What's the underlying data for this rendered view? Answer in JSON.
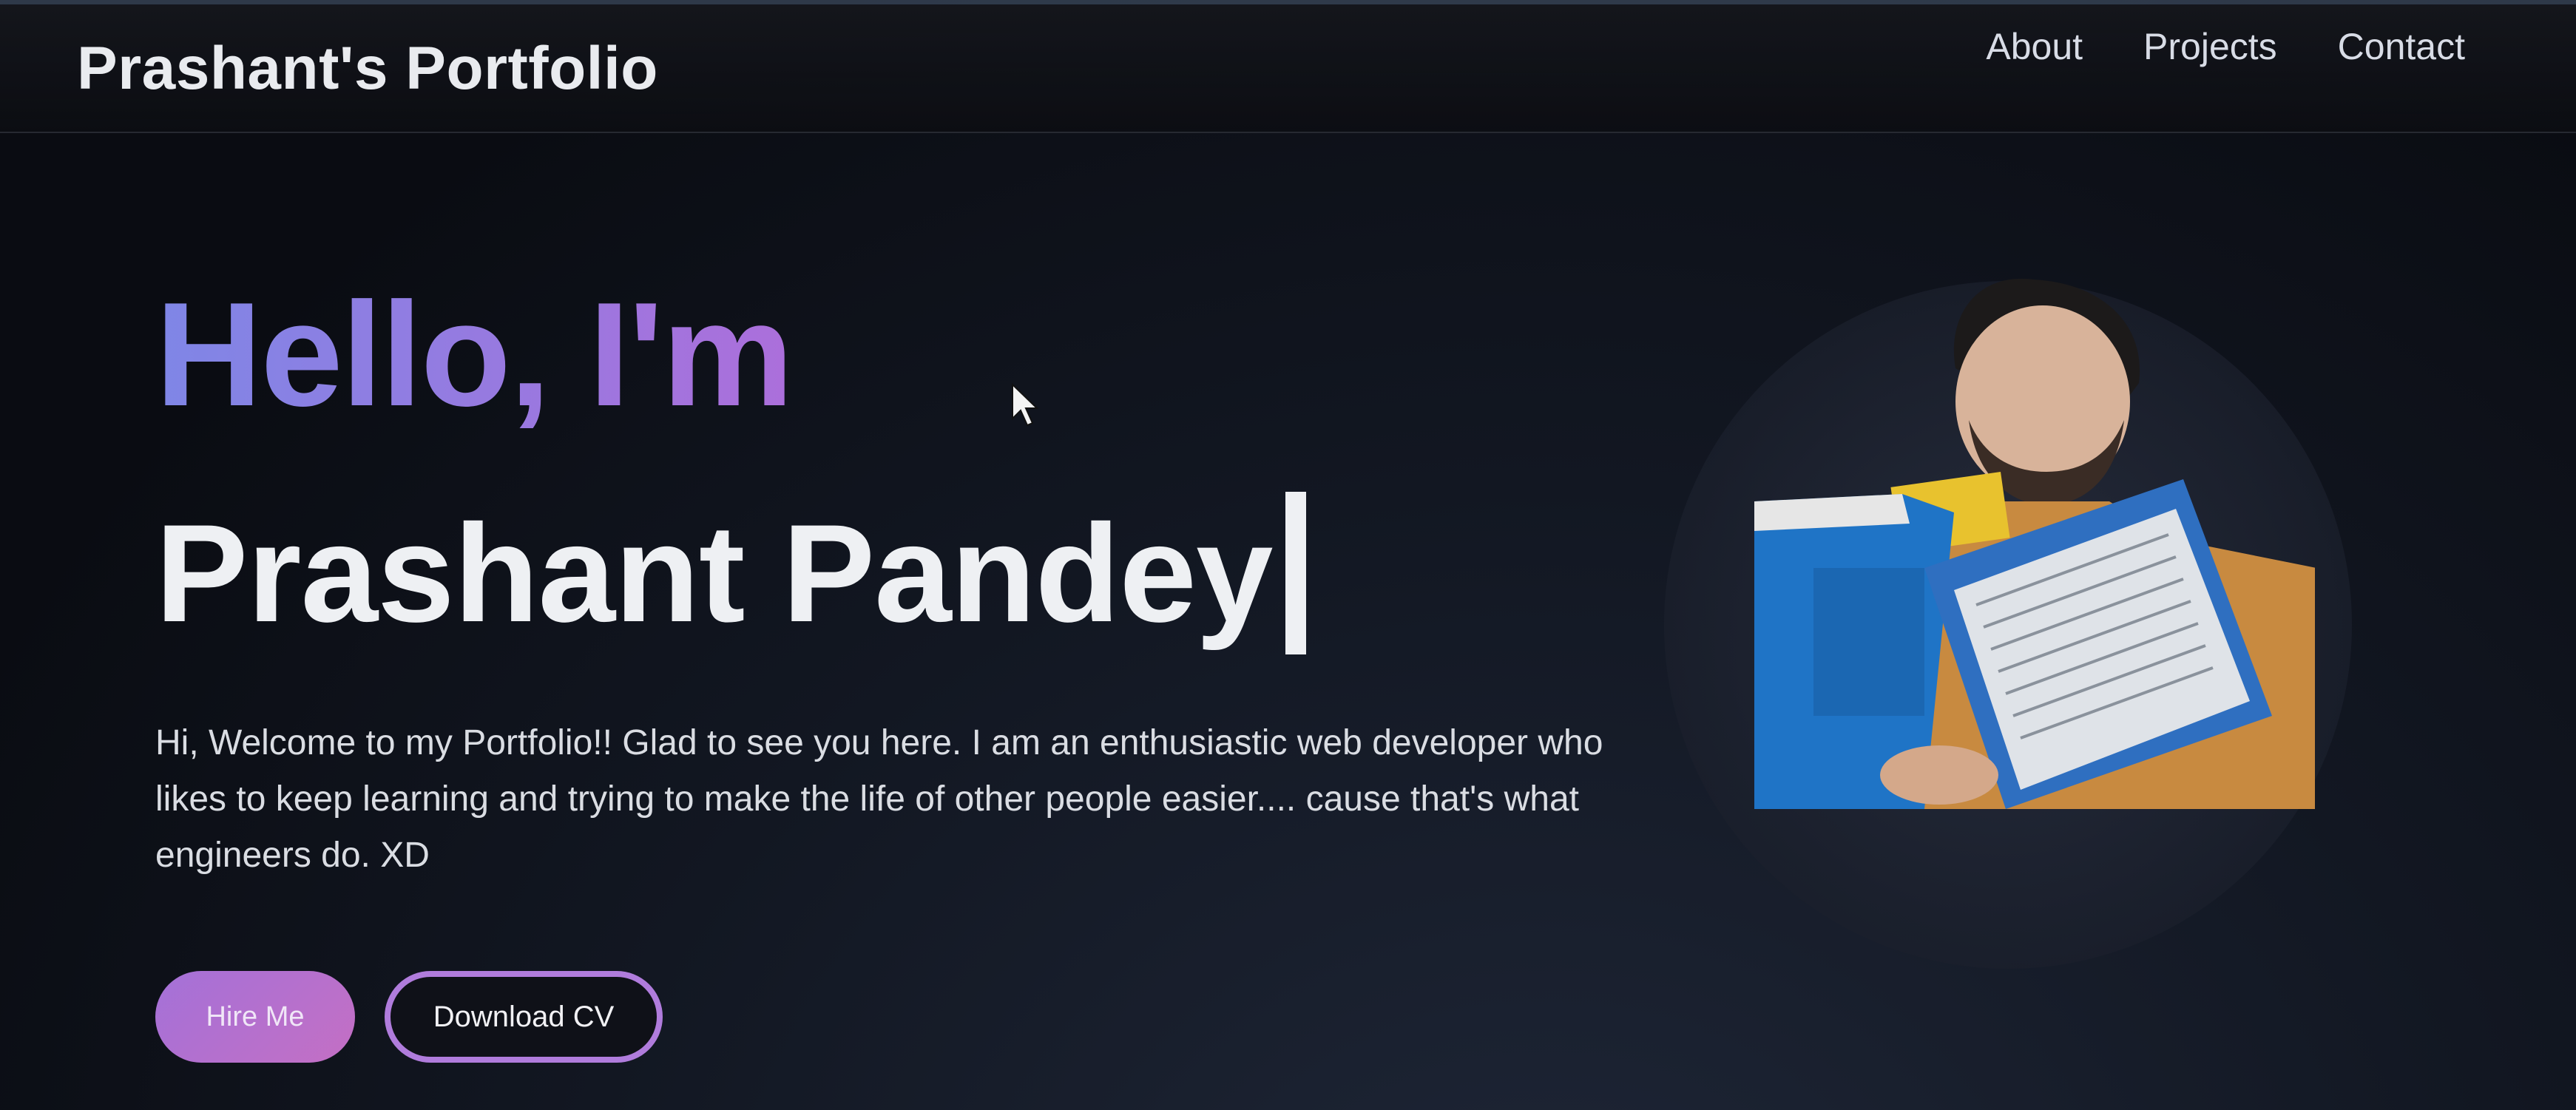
{
  "brand": "Prashant's Portfolio",
  "nav": [
    "About",
    "Projects",
    "Contact"
  ],
  "hero": {
    "greeting": "Hello, I'm",
    "name": "Prashant Pandey",
    "intro": "Hi, Welcome to my Portfolio!! Glad to see you here. I am an enthusiastic web developer who likes to keep learning and trying to make the life of other people easier.... cause that's what engineers do. XD",
    "buttons": {
      "hire": "Hire Me",
      "cv": "Download CV"
    }
  },
  "colors": {
    "accent_start": "#7f86e6",
    "accent_end": "#e04fa8",
    "button_border": "#b07cdc"
  },
  "icons": {
    "cursor": "mouse-pointer-icon",
    "photo": "profile-photo"
  }
}
